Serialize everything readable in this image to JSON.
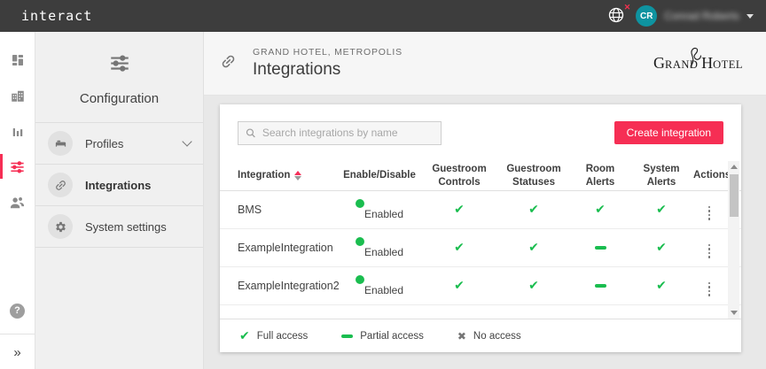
{
  "topbar": {
    "logo": "interact",
    "globe_badge": "✕",
    "user_initials": "CR",
    "user_name": "Conrad Roberts"
  },
  "primary_sidebar": {
    "icons": [
      "dashboard-icon",
      "hotel-icon",
      "analytics-icon",
      "configuration-icon",
      "users-icon",
      "help-icon",
      "collapse-icon"
    ]
  },
  "secondary_sidebar": {
    "title": "Configuration",
    "items": [
      {
        "label": "Profiles",
        "icon": "bed-icon",
        "expandable": true,
        "active": false
      },
      {
        "label": "Integrations",
        "icon": "link-icon",
        "expandable": false,
        "active": true
      },
      {
        "label": "System settings",
        "icon": "gear-icon",
        "expandable": false,
        "active": false
      }
    ]
  },
  "header": {
    "breadcrumb": "GRAND HOTEL, METROPOLIS",
    "title": "Integrations",
    "brand": {
      "word1": "Grand",
      "word2": "Hotel"
    }
  },
  "toolbar": {
    "search_placeholder": "Search integrations by name",
    "create_label": "Create integration"
  },
  "table": {
    "columns": [
      "Integration",
      "Enable/Disable",
      "Guestroom Controls",
      "Guestroom Statuses",
      "Room Alerts",
      "System Alerts",
      "Actions"
    ],
    "rows": [
      {
        "name": "BMS",
        "status": "Enabled",
        "access": [
          "full",
          "full",
          "full",
          "full"
        ]
      },
      {
        "name": "ExampleIntegration",
        "status": "Enabled",
        "access": [
          "full",
          "full",
          "partial",
          "full"
        ]
      },
      {
        "name": "ExampleIntegration2",
        "status": "Enabled",
        "access": [
          "full",
          "full",
          "partial",
          "full"
        ]
      }
    ]
  },
  "legend": {
    "items": [
      {
        "symbol": "full",
        "label": "Full access"
      },
      {
        "symbol": "partial",
        "label": "Partial access"
      },
      {
        "symbol": "no",
        "label": "No access"
      }
    ]
  },
  "symbols": {
    "full": "✔",
    "partial": "–",
    "no": "✖"
  },
  "colors": {
    "accent": "#f62e54",
    "green": "#1abd4f",
    "avatar_teal": "#0e93a0",
    "topbar": "#3d3d3d"
  }
}
